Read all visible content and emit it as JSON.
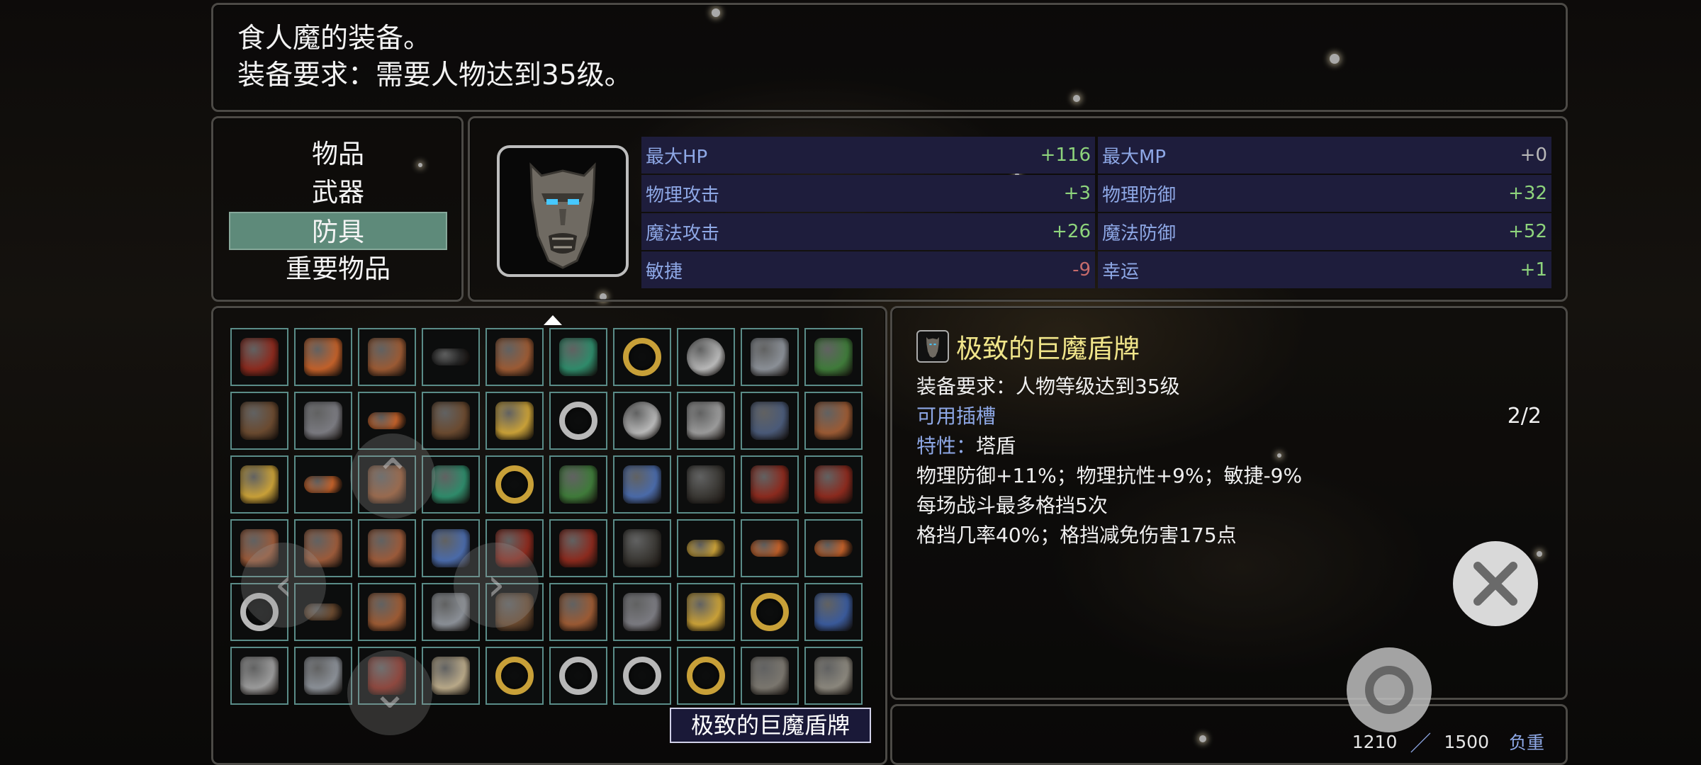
{
  "description": {
    "line1": "食人魔的装备。",
    "line2": "装备要求：需要人物达到35级。"
  },
  "categories": [
    {
      "label": "物品",
      "selected": false
    },
    {
      "label": "武器",
      "selected": false
    },
    {
      "label": "防具",
      "selected": true
    },
    {
      "label": "重要物品",
      "selected": false
    }
  ],
  "stats": {
    "rows": [
      [
        {
          "label": "最大HP",
          "value": "+116"
        },
        {
          "label": "最大MP",
          "value": "+0"
        }
      ],
      [
        {
          "label": "物理攻击",
          "value": "+3"
        },
        {
          "label": "物理防御",
          "value": "+32"
        }
      ],
      [
        {
          "label": "魔法攻击",
          "value": "+26"
        },
        {
          "label": "魔法防御",
          "value": "+52"
        }
      ],
      [
        {
          "label": "敏捷",
          "value": "-9"
        },
        {
          "label": "幸运",
          "value": "+1"
        }
      ]
    ]
  },
  "inventory": {
    "selected_index": 58,
    "selected_name": "极致的巨魔盾牌",
    "items": [
      "red-armor-icon",
      "orange-gloves-icon",
      "leather-gloves-icon",
      "black-belt-icon",
      "leather-boots-icon",
      "emerald-amulet-icon",
      "gold-ring-icon",
      "silver-orb-icon",
      "steel-helmet-icon",
      "green-cloak-icon",
      "brown-robe-icon",
      "grey-gauntlets-icon",
      "orange-belt-icon",
      "brown-boots-icon",
      "gold-necklace-icon",
      "silver-ring-icon",
      "silver-orb-icon",
      "horned-helmet-icon",
      "chainmail-icon",
      "leather-cloak-icon",
      "gold-gauntlets-icon",
      "orange-belt-icon",
      "leather-boots-icon",
      "emerald-amulet-icon",
      "gold-ring-icon",
      "green-armor-icon",
      "blue-chestplate-icon",
      "dark-chainmail-icon",
      "red-armor-icon",
      "red-armor-icon",
      "bronze-chest-icon",
      "bronze-chest-icon",
      "bronze-chest-icon",
      "blue-armor-icon",
      "red-armor-icon",
      "red-armor-icon",
      "dark-cloak-icon",
      "gold-belt-icon",
      "orange-belt-icon",
      "orange-belt-icon",
      "silver-ring-icon",
      "brown-belt-icon",
      "leather-boots-icon",
      "steel-boots-icon",
      "brown-boots-icon",
      "leather-gloves-icon",
      "grey-gauntlets-icon",
      "gold-bracer-icon",
      "gold-ring-icon",
      "wizard-hat-icon",
      "horned-helmet-icon",
      "steel-helmet-icon",
      "red-net-icon",
      "bone-necklace-icon",
      "gold-ring-icon",
      "silver-ring-icon",
      "silver-ring-icon",
      "gold-ring-icon",
      "demon-shield-icon",
      "stone-armor-icon"
    ]
  },
  "detail": {
    "name": "极致的巨魔盾牌",
    "requirement": "装备要求：人物等级达到35级",
    "slots_label": "可用插槽",
    "slots_count": "2/2",
    "trait_label": "特性：",
    "trait_value": "塔盾",
    "effect1": "物理防御+11%；物理抗性+9%；敏捷-9%",
    "effect2": "每场战斗最多格挡5次",
    "effect3": "格挡几率40%；格挡减免伤害175点"
  },
  "weight": {
    "current": "1210",
    "max": "1500",
    "label": "负重"
  },
  "colors": {
    "selected_category": "#5e8a7a",
    "stat_label": "#8ea8e6",
    "stat_positive": "#8ed47c",
    "stat_negative": "#c66b6b",
    "item_name": "#f0e58a",
    "slot_border": "#5a8c88"
  }
}
